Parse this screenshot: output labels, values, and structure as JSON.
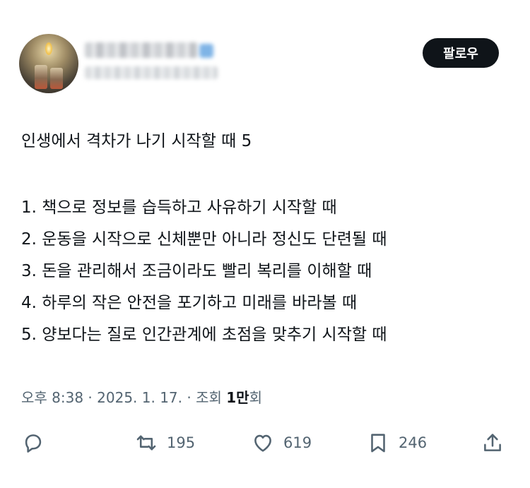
{
  "header": {
    "follow_label": "팔로우"
  },
  "post": {
    "title": "인생에서 격차가 나기 시작할 때 5",
    "items": [
      "1. 책으로 정보를 습득하고 사유하기 시작할 때",
      "2. 운동을 시작으로 신체뿐만 아니라 정신도 단련될 때",
      "3. 돈을 관리해서 조금이라도 빨리 복리를 이해할 때",
      "4. 하루의 작은 안전을 포기하고 미래를 바라볼 때",
      "5. 양보다는 질로 인간관계에 초점을 맞추기 시작할 때"
    ]
  },
  "meta": {
    "time": "오후 8:38",
    "sep1": " · ",
    "date": "2025. 1. 17.",
    "sep2": " · ",
    "views_label": "조회 ",
    "views_num": "1만",
    "views_suffix": "회"
  },
  "actions": {
    "retweets": "195",
    "likes": "619",
    "bookmarks": "246"
  },
  "icons": {
    "reply": "reply-icon",
    "retweet": "retweet-icon",
    "like": "heart-icon",
    "bookmark": "bookmark-icon",
    "share": "share-icon"
  },
  "colors": {
    "text": "#0f1419",
    "secondary": "#536471",
    "follow_bg": "#0f1419"
  }
}
